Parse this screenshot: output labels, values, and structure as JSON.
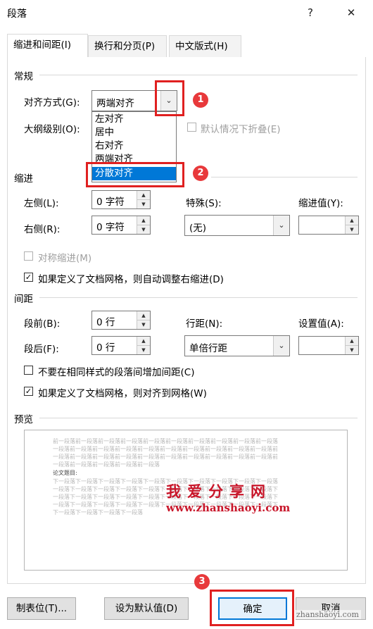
{
  "dialog": {
    "title": "段落",
    "help_glyph": "?",
    "close_glyph": "✕"
  },
  "tabs": [
    {
      "label": "缩进和间距(I)"
    },
    {
      "label": "换行和分页(P)"
    },
    {
      "label": "中文版式(H)"
    }
  ],
  "general": {
    "section": "常规",
    "alignment_label": "对齐方式(G):",
    "alignment_value": "两端对齐",
    "outline_label": "大纲级别(O):",
    "collapse_label": "默认情况下折叠(E)",
    "dropdown_options": [
      "左对齐",
      "居中",
      "右对齐",
      "两端对齐",
      "分散对齐"
    ],
    "dropdown_selected": "分散对齐"
  },
  "indent": {
    "section": "缩进",
    "left_label": "左侧(L):",
    "left_value": "0 字符",
    "right_label": "右侧(R):",
    "right_value": "0 字符",
    "special_label": "特殊(S):",
    "special_value": "(无)",
    "indent_value_label": "缩进值(Y):",
    "indent_value": "",
    "mirror_label": "对称缩进(M)",
    "auto_adjust_label": "如果定义了文档网格，则自动调整右缩进(D)"
  },
  "spacing": {
    "section": "间距",
    "before_label": "段前(B):",
    "before_value": "0 行",
    "after_label": "段后(F):",
    "after_value": "0 行",
    "line_label": "行距(N):",
    "line_value": "单倍行距",
    "setting_label": "设置值(A):",
    "setting_value": "",
    "no_space_label": "不要在相同样式的段落间增加间距(C)",
    "snap_grid_label": "如果定义了文档网格，则对齐到网格(W)"
  },
  "preview": {
    "section": "预览",
    "prev_lines": [
      "前一段落前一段落前一段落前一段落前一段落前一段落前一段落前一段落前一段落前一段落",
      "一段落前一段落前一段落前一段落前一段落前一段落前一段落前一段落前一段落前一段落前",
      "一段落前一段落前一段落前一段落前一段落前一段落前一段落前一段落前一段落前一段落前",
      "一段落前一段落前一段落前一段落前一段落"
    ],
    "current_line": "论文题目:",
    "next_lines": [
      "下一段落下一段落下一段落下一段落下一段落下一段落下一段落下一段落下一段落下一段落",
      "一段落下一段落下一段落下一段落下一段落下一段落下一段落下一段落下一段落下一段落下",
      "一段落下一段落下一段落下一段落下一段落下一段落下一段落下一段落下一段落下一段落下",
      "一段落下一段落下一段落下一段落下一段落下一段落下一段落下一段落下一段落下一段落下",
      "下一段落下一段落下一段落下一段落"
    ]
  },
  "watermark": {
    "cn": "我爱分享网",
    "en": "www.zhanshaoyi.com",
    "corner": "zhanshaoyi.com"
  },
  "annotations": [
    "1",
    "2",
    "3"
  ],
  "buttons": {
    "tabs": "制表位(T)...",
    "default": "设为默认值(D)",
    "ok": "确定",
    "cancel": "取消"
  },
  "colors": {
    "selection": "#0078d7",
    "annotation_red": "#e02020",
    "watermark_red": "#c8162a"
  }
}
